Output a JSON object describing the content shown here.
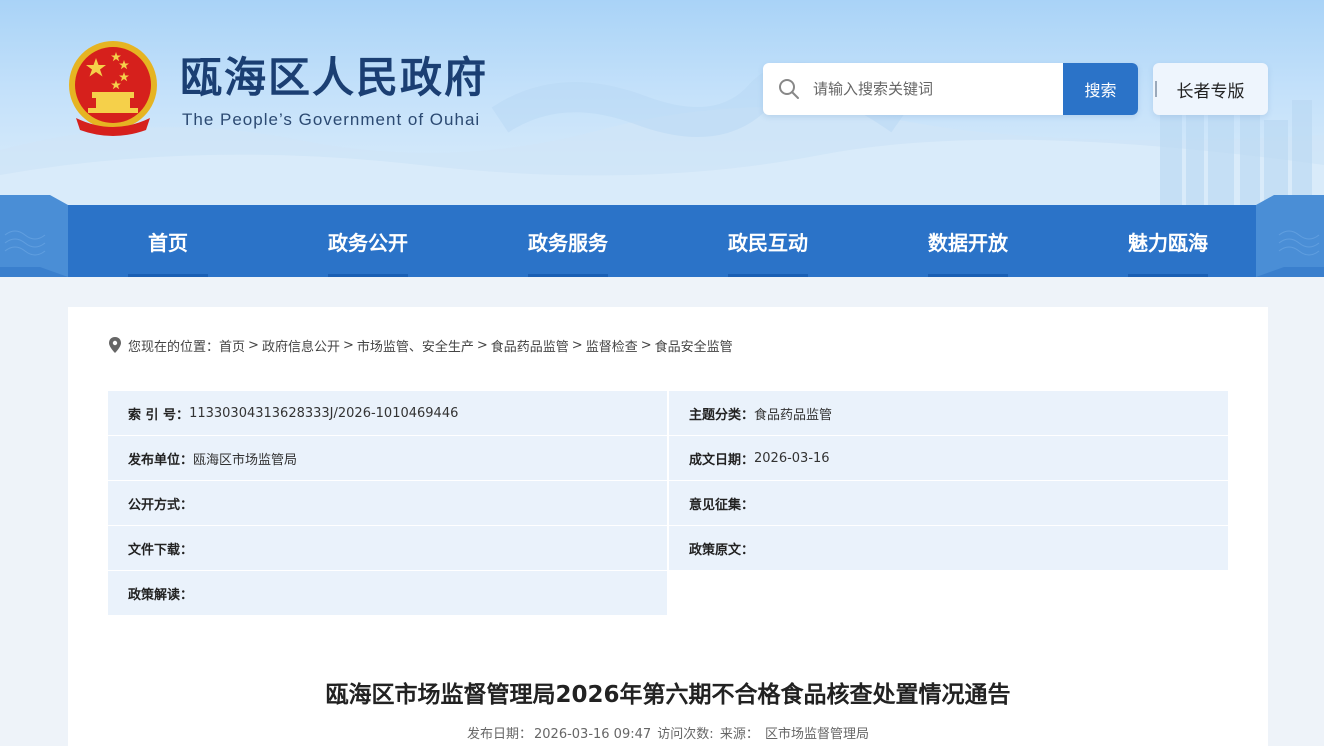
{
  "header": {
    "title": "瓯海区人民政府",
    "subtitle": "The People’s Government of Ouhai"
  },
  "search": {
    "placeholder": "请输入搜索关键词",
    "button_label": "搜索"
  },
  "elder_mode_label": "长者专版",
  "nav": {
    "items": [
      {
        "label": "首页"
      },
      {
        "label": "政务公开"
      },
      {
        "label": "政务服务"
      },
      {
        "label": "政民互动"
      },
      {
        "label": "数据开放"
      },
      {
        "label": "魅力瓯海"
      }
    ]
  },
  "breadcrumb": {
    "prefix": "您现在的位置：",
    "items": [
      "首页",
      "政府信息公开",
      "市场监管、安全生产",
      "食品药品监管",
      "监督检查",
      "食品安全监管"
    ]
  },
  "meta": {
    "index_label": "索 引 号：",
    "index_value": "11330304313628333J/2026-1010469446",
    "topic_label": "主题分类：",
    "topic_value": "食品药品监管",
    "publisher_label": "发布单位：",
    "publisher_value": "瓯海区市场监管局",
    "date_label": "成文日期：",
    "date_value": "2026-03-16",
    "disclosure_label": "公开方式：",
    "opinion_label": "意见征集：",
    "download_label": "文件下载：",
    "original_label": "政策原文：",
    "interpretation_label": "政策解读："
  },
  "article": {
    "title": "瓯海区市场监督管理局2026年第六期不合格食品核查处置情况通告",
    "publish_label": "发布日期：",
    "publish_value": "2026-03-16 09:47",
    "visits_label": "访问次数:",
    "source_label": "来源：",
    "source_value": "区市场监督管理局"
  },
  "colors": {
    "brand_blue": "#2b73c8",
    "title_navy": "#1b3f73",
    "table_bg": "#eaf2fb"
  }
}
